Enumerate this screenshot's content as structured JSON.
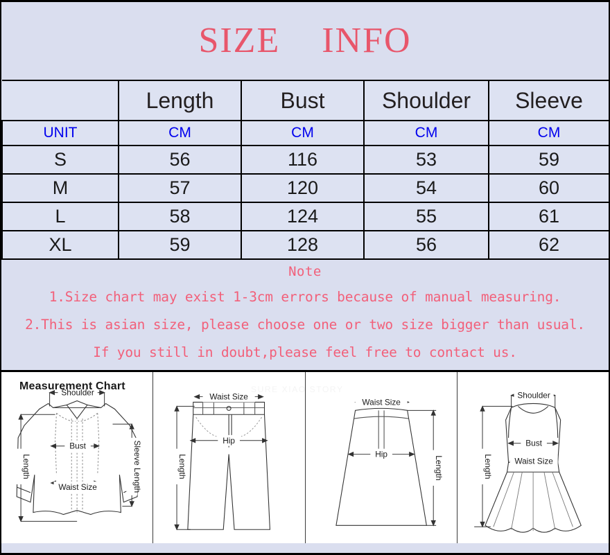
{
  "title": "SIZE    INFO",
  "colors": {
    "page_background": "#dadeef",
    "table_cell_background": "#dde2f2",
    "title_red": "#e8566b",
    "note_red": "#f2607a",
    "unit_blue": "#0000ee",
    "header_text": "#231f20",
    "border_black": "#000000"
  },
  "table": {
    "headers": [
      "",
      "Length",
      "Bust",
      "Shoulder",
      "Sleeve"
    ],
    "unit_row": [
      "UNIT",
      "CM",
      "CM",
      "CM",
      "CM"
    ],
    "rows": [
      {
        "size": "S",
        "length": "56",
        "bust": "116",
        "shoulder": "53",
        "sleeve": "59"
      },
      {
        "size": "M",
        "length": "57",
        "bust": "120",
        "shoulder": "54",
        "sleeve": "60"
      },
      {
        "size": "L",
        "length": "58",
        "bust": "124",
        "shoulder": "55",
        "sleeve": "61"
      },
      {
        "size": "XL",
        "length": "59",
        "bust": "128",
        "shoulder": "56",
        "sleeve": "62"
      }
    ]
  },
  "note": {
    "heading": "Note",
    "line1": "1.Size chart may exist 1-3cm errors because of manual measuring.",
    "line2": "2.This is asian size, please choose one or two size bigger than usual.",
    "line3": "If you still in doubt,please feel free to contact us."
  },
  "measurement": {
    "heading": "Measurement Chart",
    "watermark": "SURE XIAO STORY",
    "diagrams": [
      {
        "garment": "shirt",
        "labels": {
          "shoulder": "Shoulder",
          "bust": "Bust",
          "waist": "Waist Size",
          "length": "Length",
          "sleeve": "Sleeve Length"
        }
      },
      {
        "garment": "pants",
        "labels": {
          "waist": "Waist Size",
          "hip": "Hip",
          "length": "Length"
        }
      },
      {
        "garment": "skirt",
        "labels": {
          "waist": "Waist Size",
          "hip": "Hip",
          "length": "Length"
        }
      },
      {
        "garment": "dress",
        "labels": {
          "shoulder": "Shoulder",
          "bust": "Bust",
          "waist": "Waist Size",
          "length": "Length"
        }
      }
    ]
  }
}
